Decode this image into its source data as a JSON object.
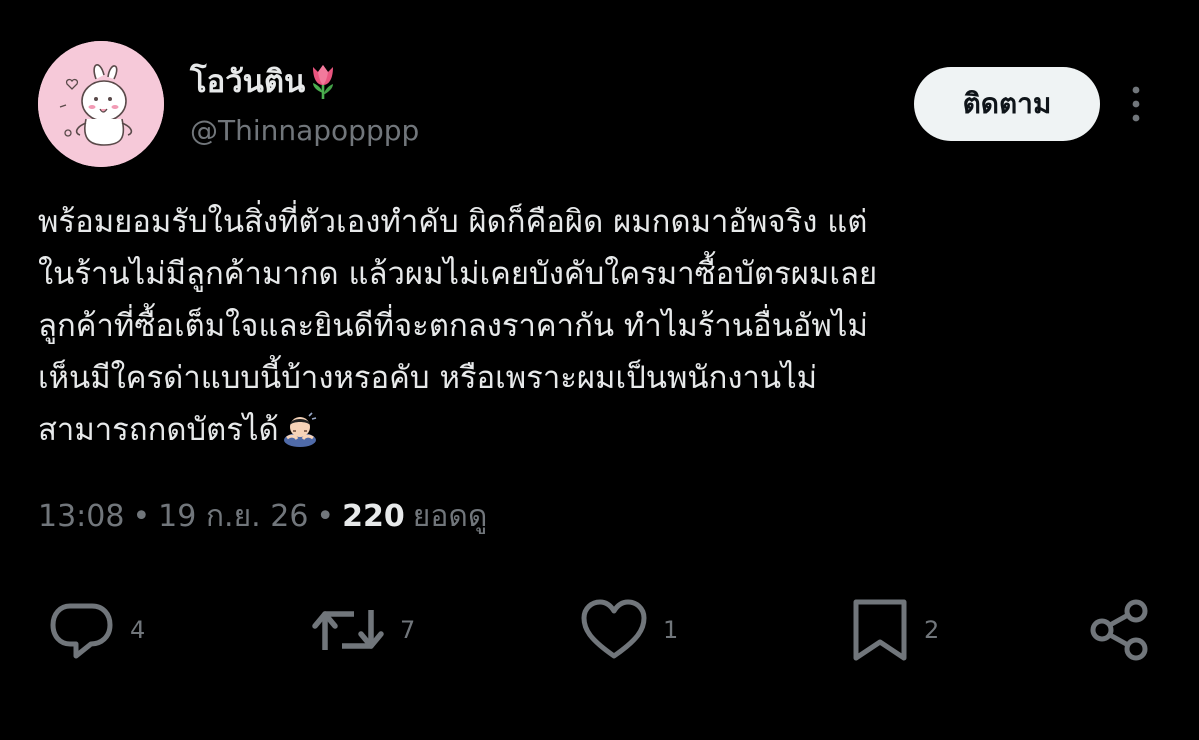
{
  "user": {
    "display_name": "โอวันติน",
    "handle": "@Thinnapopppp",
    "avatar_icon": "cartoon-rabbit-avatar",
    "name_emoji_icon": "tulip-icon"
  },
  "header": {
    "follow_label": "ติดตาม",
    "more_icon": "more-vertical-icon"
  },
  "tweet": {
    "lines": [
      "พร้อมยอมรับในสิ่งที่ตัวเองทำคับ ผิดก็คือผิด ผมกดมาอัพจริง แต่",
      "ในร้านไม่มีลูกค้ามากด แล้วผมไม่เคยบังคับใครมาซื้อบัตรผมเลย",
      "ลูกค้าที่ซื้อเต็มใจและยินดีที่จะตกลงราคากัน ทำไมร้านอื่นอัพไม่",
      "เห็นมีใครด่าแบบนี้บ้างหรอคับ หรือเพราะผมเป็นพนักงานไม่",
      "สามารถกดบัตรได้"
    ],
    "trailing_emoji_icon": "person-bowing-icon"
  },
  "meta": {
    "time": "13:08",
    "separator": "•",
    "date": "19 ก.ย. 26",
    "views_count": "220",
    "views_label": "ยอดดู"
  },
  "actions": {
    "replies": "4",
    "retweets": "7",
    "likes": "1",
    "bookmarks": "2"
  },
  "colors": {
    "background": "#000000",
    "text_primary": "#e7e9ea",
    "text_secondary": "#71767b",
    "follow_button_bg": "#eff3f4",
    "avatar_bg": "#f6c9d9"
  }
}
